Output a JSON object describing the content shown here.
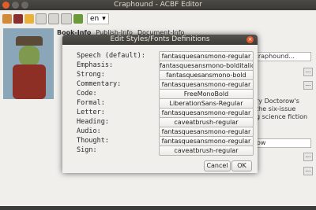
{
  "window": {
    "title": "Craphound - ACBF Editor"
  },
  "toolbar": {
    "icons": [
      "open-folder-icon",
      "tools-icon",
      "star-icon",
      "document-icon",
      "document-icon",
      "document-icon",
      "download-icon"
    ],
    "language": "en"
  },
  "tabs": [
    "Book-Info",
    "Publish-Info",
    "Document-Info"
  ],
  "background_fields": {
    "email_fragment": "ow@craphound...",
    "desc_line1": "ry Doctorow's",
    "desc_line2": "the six-issue",
    "desc_line3": "g science fiction",
    "field_ow": "ow",
    "dots": "..."
  },
  "dialog": {
    "title": "Edit Styles/Fonts Definitions",
    "close_label": "×",
    "rows": [
      {
        "label": "Speech (default):",
        "font": "fantasquesansmono-regular"
      },
      {
        "label": "Emphasis:",
        "font": "fantasquesansmono-bolditalic"
      },
      {
        "label": "Strong:",
        "font": "fantasquesansmono-bold"
      },
      {
        "label": "Commentary:",
        "font": "fantasquesansmono-regular"
      },
      {
        "label": "Code:",
        "font": "FreeMonoBold"
      },
      {
        "label": "Formal:",
        "font": "LiberationSans-Regular"
      },
      {
        "label": "Letter:",
        "font": "fantasquesansmono-regular"
      },
      {
        "label": "Heading:",
        "font": "caveatbrush-regular"
      },
      {
        "label": "Audio:",
        "font": "fantasquesansmono-regular"
      },
      {
        "label": "Thought:",
        "font": "fantasquesansmono-regular"
      },
      {
        "label": "Sign:",
        "font": "caveatbrush-regular"
      }
    ],
    "cancel_label": "Cancel",
    "ok_label": "OK"
  },
  "colors": {
    "accent_close": "#e35c2c",
    "titlebar": "#3c3b37"
  }
}
